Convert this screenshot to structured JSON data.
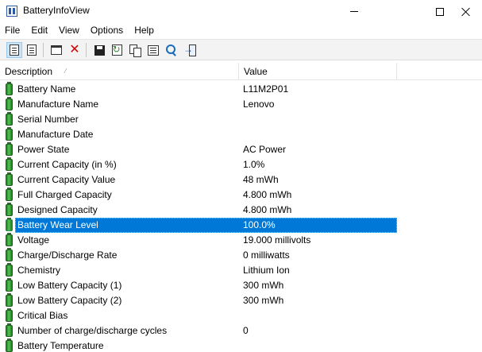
{
  "window": {
    "title": "BatteryInfoView"
  },
  "menu": [
    "File",
    "Edit",
    "View",
    "Options",
    "Help"
  ],
  "toolbar": {
    "icons": [
      "html-report-icon",
      "text-report-icon",
      "window-icon",
      "delete-icon",
      "save-icon",
      "refresh-icon",
      "copy-icon",
      "properties-icon",
      "find-icon",
      "exit-icon"
    ]
  },
  "columns": {
    "description": "Description",
    "value": "Value"
  },
  "rows": [
    {
      "description": "Battery Name",
      "value": "L11M2P01"
    },
    {
      "description": "Manufacture Name",
      "value": "Lenovo"
    },
    {
      "description": "Serial Number",
      "value": ""
    },
    {
      "description": "Manufacture Date",
      "value": ""
    },
    {
      "description": "Power State",
      "value": "AC Power"
    },
    {
      "description": "Current Capacity (in %)",
      "value": "1.0%"
    },
    {
      "description": "Current Capacity Value",
      "value": "48 mWh"
    },
    {
      "description": "Full Charged Capacity",
      "value": "4.800 mWh"
    },
    {
      "description": "Designed Capacity",
      "value": "4.800 mWh"
    },
    {
      "description": "Battery Wear Level",
      "value": "100.0%",
      "selected": true
    },
    {
      "description": "Voltage",
      "value": "19.000 millivolts"
    },
    {
      "description": "Charge/Discharge Rate",
      "value": "0 milliwatts"
    },
    {
      "description": "Chemistry",
      "value": "Lithium Ion"
    },
    {
      "description": "Low Battery Capacity (1)",
      "value": "300 mWh"
    },
    {
      "description": "Low Battery Capacity (2)",
      "value": "300 mWh"
    },
    {
      "description": "Critical Bias",
      "value": ""
    },
    {
      "description": "Number of charge/discharge cycles",
      "value": "0"
    },
    {
      "description": "Battery Temperature",
      "value": ""
    }
  ],
  "colors": {
    "selection": "#0078d7",
    "battery": "#3aa63a"
  }
}
